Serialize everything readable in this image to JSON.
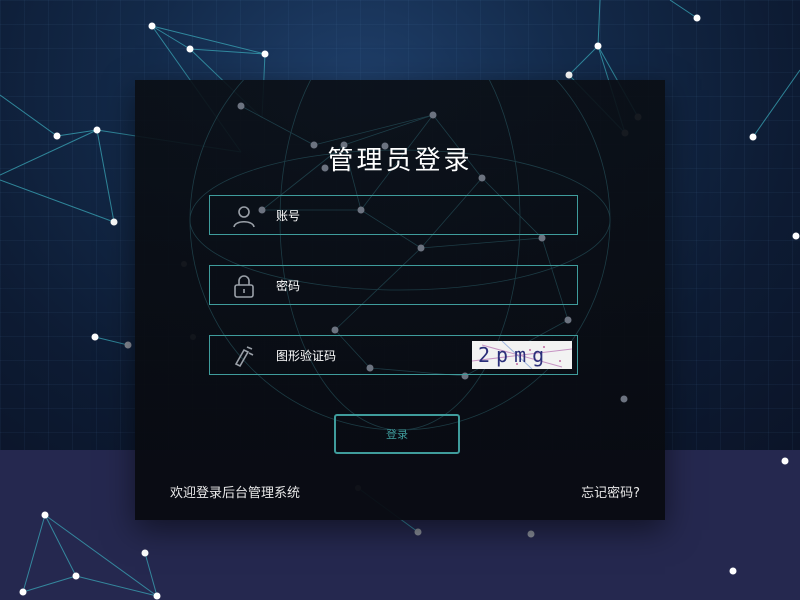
{
  "page": {
    "title": "管理员登录"
  },
  "form": {
    "account_label": "账号",
    "password_label": "密码",
    "captcha_label": "图形验证码",
    "captcha_text": "2pmg",
    "login_button": "登录"
  },
  "footer": {
    "welcome": "欢迎登录后台管理系统",
    "forgot_password": "忘记密码?"
  },
  "icons": {
    "account": "user-icon",
    "password": "lock-icon",
    "captcha": "captcha-icon"
  },
  "colors": {
    "accent": "#3f9c9c",
    "panel": "#0a0d14",
    "bottom_band": "#25284f"
  }
}
